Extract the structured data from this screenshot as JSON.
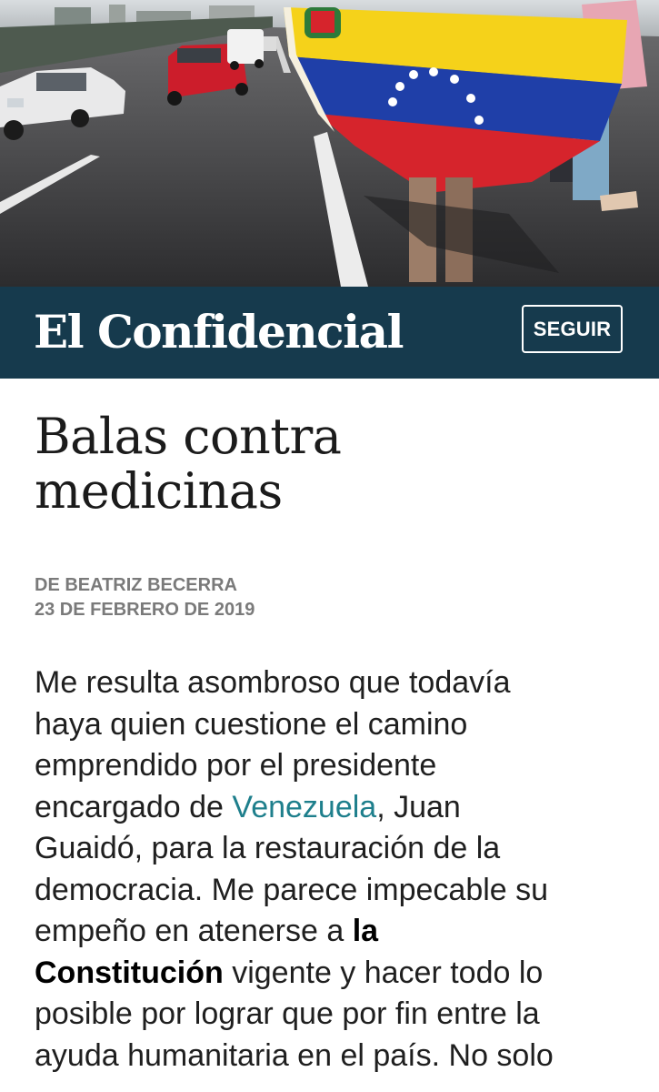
{
  "masthead": {
    "logo_text": "El Confidencial",
    "follow_label": "SEGUIR",
    "background": "#163a4d"
  },
  "article": {
    "headline_line1": "Balas contra",
    "headline_line2": "medicinas",
    "author": "DE BEATRIZ BECERRA",
    "date": "23 DE FEBRERO DE 2019",
    "body": {
      "l1": "Me resulta asombroso que todavía",
      "l2": "haya quien cuestione el camino",
      "l3": "emprendido por el presidente",
      "l4_a": "encargado de ",
      "l4_link": "Venezuela",
      "l4_b": ", Juan",
      "l5": "Guaidó, para la restauración de la",
      "l6": "democracia. Me parece impecable su",
      "l7_a": "empeño en atenerse a ",
      "l7_bold": "la",
      "l8_bold": "Constitución",
      "l8_b": " vigente y hacer todo lo",
      "l9": "posible por lograr que por fin entre la",
      "l10": "ayuda humanitaria en el país. No solo"
    },
    "link_color": "#1e7f8c"
  },
  "hero": {
    "icon": "venezuelan-flag-protest-photo"
  }
}
